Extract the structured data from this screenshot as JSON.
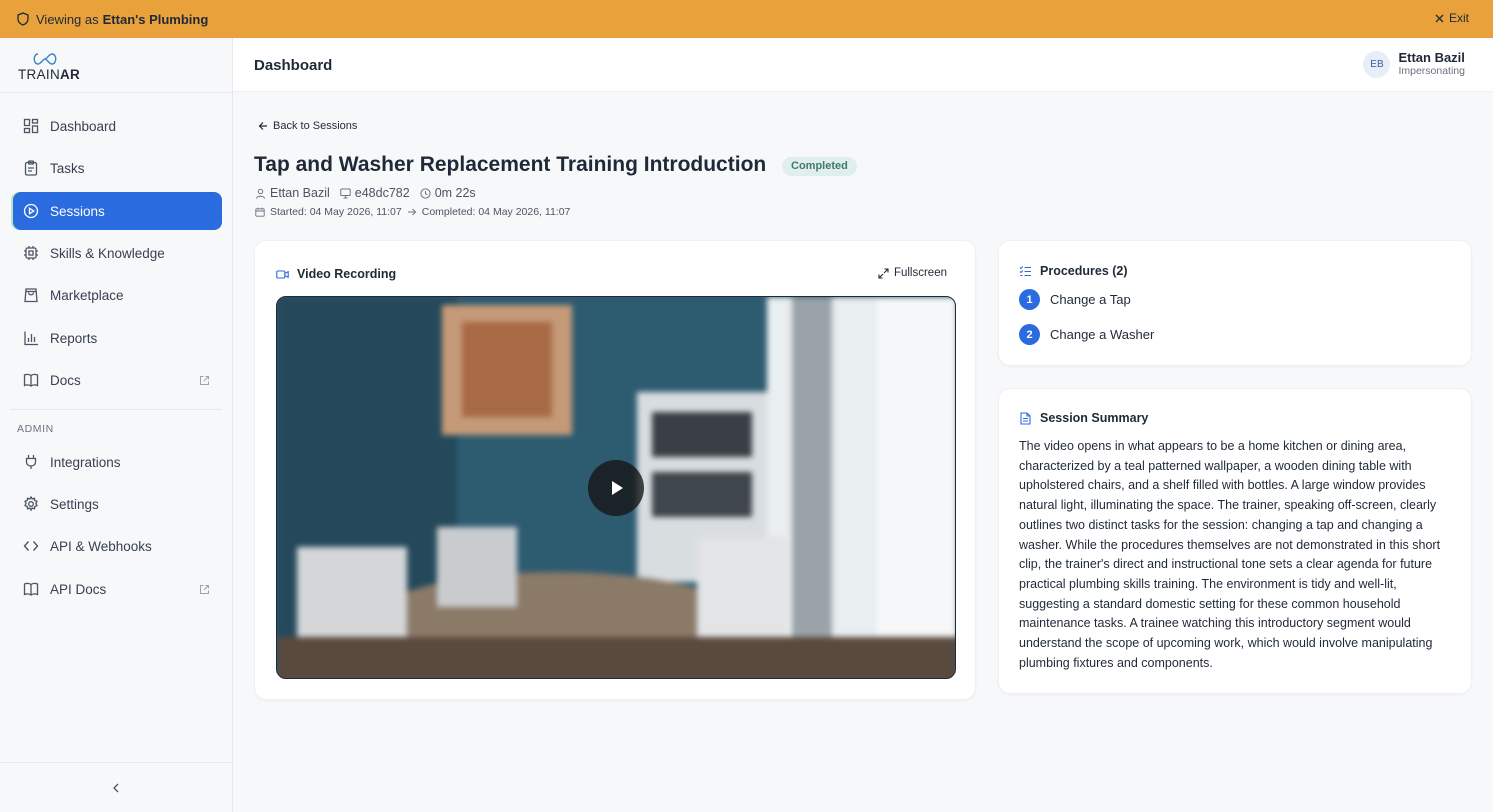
{
  "banner": {
    "prefix": "Viewing as",
    "org": "Ettan's Plumbing",
    "exit_label": "Exit",
    "color": "#e9a23b"
  },
  "sidebar": {
    "logo": {
      "part1": "TRAIN",
      "part2": "AR"
    },
    "items": [
      {
        "label": "Dashboard",
        "icon": "dashboard-icon"
      },
      {
        "label": "Tasks",
        "icon": "clipboard-icon"
      },
      {
        "label": "Sessions",
        "icon": "play-circle-icon",
        "active": true
      },
      {
        "label": "Skills & Knowledge",
        "icon": "chip-icon"
      },
      {
        "label": "Marketplace",
        "icon": "shopping-bag-icon"
      },
      {
        "label": "Reports",
        "icon": "bar-chart-icon"
      },
      {
        "label": "Docs",
        "icon": "book-icon",
        "external": true
      }
    ],
    "admin_label": "ADMIN",
    "admin_items": [
      {
        "label": "Integrations",
        "icon": "plug-icon"
      },
      {
        "label": "Settings",
        "icon": "gear-icon"
      },
      {
        "label": "API & Webhooks",
        "icon": "code-icon"
      },
      {
        "label": "API Docs",
        "icon": "book-icon",
        "external": true
      }
    ],
    "accent": "#2a6be0"
  },
  "header": {
    "title": "Dashboard",
    "user": {
      "initials": "EB",
      "name": "Ettan Bazil",
      "role": "Impersonating"
    }
  },
  "session": {
    "back_label": "Back to Sessions",
    "title": "Tap and Washer Replacement Training Introduction",
    "status": "Completed",
    "trainee": "Ettan Bazil",
    "device": "e48dc782",
    "duration": "0m 22s",
    "started": "Started: 04 May 2026, 11:07",
    "completed": "Completed: 04 May 2026, 11:07"
  },
  "video": {
    "heading": "Video Recording",
    "fullscreen_label": "Fullscreen"
  },
  "procedures": {
    "heading": "Procedures (2)",
    "items": [
      {
        "num": "1",
        "label": "Change a Tap"
      },
      {
        "num": "2",
        "label": "Change a Washer"
      }
    ]
  },
  "summary": {
    "heading": "Session Summary",
    "text": "The video opens in what appears to be a home kitchen or dining area, characterized by a teal patterned wallpaper, a wooden dining table with upholstered chairs, and a shelf filled with bottles. A large window provides natural light, illuminating the space. The trainer, speaking off-screen, clearly outlines two distinct tasks for the session: changing a tap and changing a washer. While the procedures themselves are not demonstrated in this short clip, the trainer's direct and instructional tone sets a clear agenda for future practical plumbing skills training. The environment is tidy and well-lit, suggesting a standard domestic setting for these common household maintenance tasks. A trainee watching this introductory segment would understand the scope of upcoming work, which would involve manipulating plumbing fixtures and components."
  }
}
